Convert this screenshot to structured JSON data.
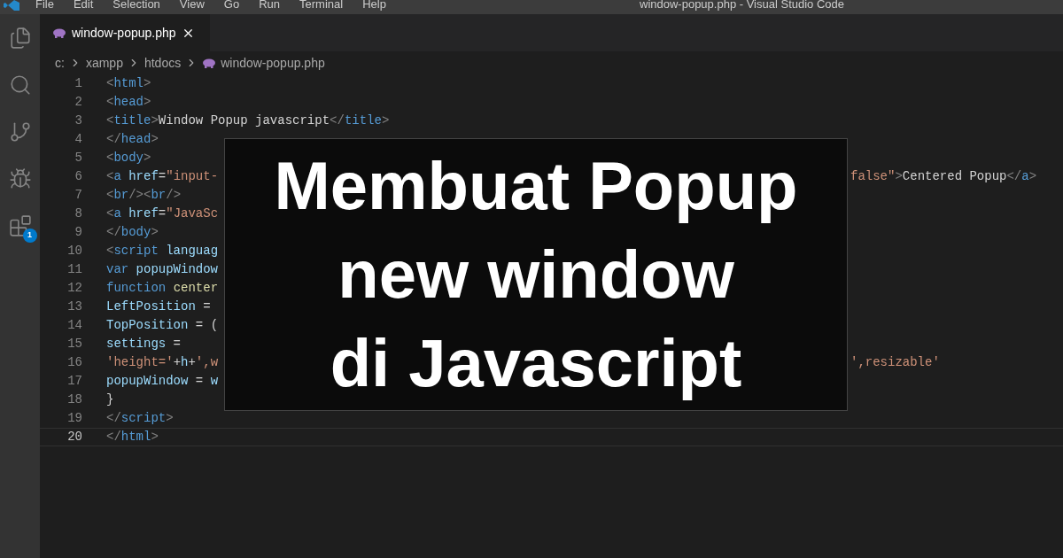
{
  "menu": [
    "File",
    "Edit",
    "Selection",
    "View",
    "Go",
    "Run",
    "Terminal",
    "Help"
  ],
  "window": {
    "title": "window-popup.php - Visual Studio Code"
  },
  "activity_bar": {
    "extensions_badge": "1"
  },
  "tabs": [
    {
      "label": "window-popup.php",
      "selected": true
    }
  ],
  "breadcrumb": [
    "c:",
    "xampp",
    "htdocs",
    "window-popup.php"
  ],
  "code_lines": [
    {
      "number": "1",
      "active": false,
      "tokens": [
        {
          "kind": "punct",
          "text": "<"
        },
        {
          "kind": "tag",
          "text": "html"
        },
        {
          "kind": "punct",
          "text": ">"
        }
      ]
    },
    {
      "number": "2",
      "active": false,
      "tokens": [
        {
          "kind": "punct",
          "text": "<"
        },
        {
          "kind": "tag",
          "text": "head"
        },
        {
          "kind": "punct",
          "text": ">"
        }
      ]
    },
    {
      "number": "3",
      "active": false,
      "tokens": [
        {
          "kind": "punct",
          "text": "<"
        },
        {
          "kind": "tag",
          "text": "title"
        },
        {
          "kind": "punct",
          "text": ">"
        },
        {
          "kind": "text",
          "text": "Window Popup javascript"
        },
        {
          "kind": "punct",
          "text": "</"
        },
        {
          "kind": "tag",
          "text": "title"
        },
        {
          "kind": "punct",
          "text": ">"
        }
      ]
    },
    {
      "number": "4",
      "active": false,
      "tokens": [
        {
          "kind": "punct",
          "text": "</"
        },
        {
          "kind": "tag",
          "text": "head"
        },
        {
          "kind": "punct",
          "text": ">"
        }
      ]
    },
    {
      "number": "5",
      "active": false,
      "tokens": [
        {
          "kind": "punct",
          "text": "<"
        },
        {
          "kind": "tag",
          "text": "body"
        },
        {
          "kind": "punct",
          "text": ">"
        }
      ]
    },
    {
      "number": "6",
      "active": false,
      "tokens": [
        {
          "kind": "punct",
          "text": "<"
        },
        {
          "kind": "tag",
          "text": "a "
        },
        {
          "kind": "attr",
          "text": "href"
        },
        {
          "kind": "text",
          "text": "="
        },
        {
          "kind": "string",
          "text": "\"input-"
        }
      ],
      "tail": [
        {
          "kind": "string",
          "text": "false\""
        },
        {
          "kind": "punct",
          "text": ">"
        },
        {
          "kind": "text",
          "text": "Centered Popup"
        },
        {
          "kind": "punct",
          "text": "</"
        },
        {
          "kind": "tag",
          "text": "a"
        },
        {
          "kind": "punct",
          "text": ">"
        }
      ]
    },
    {
      "number": "7",
      "active": false,
      "tokens": [
        {
          "kind": "punct",
          "text": "<"
        },
        {
          "kind": "tag",
          "text": "br"
        },
        {
          "kind": "punct",
          "text": "/><"
        },
        {
          "kind": "tag",
          "text": "br"
        },
        {
          "kind": "punct",
          "text": "/>"
        }
      ]
    },
    {
      "number": "8",
      "active": false,
      "tokens": [
        {
          "kind": "punct",
          "text": "<"
        },
        {
          "kind": "tag",
          "text": "a "
        },
        {
          "kind": "attr",
          "text": "href"
        },
        {
          "kind": "text",
          "text": "="
        },
        {
          "kind": "string",
          "text": "\"JavaSc"
        }
      ]
    },
    {
      "number": "9",
      "active": false,
      "tokens": [
        {
          "kind": "punct",
          "text": "</"
        },
        {
          "kind": "tag",
          "text": "body"
        },
        {
          "kind": "punct",
          "text": ">"
        }
      ]
    },
    {
      "number": "10",
      "active": false,
      "tokens": [
        {
          "kind": "punct",
          "text": "<"
        },
        {
          "kind": "tag",
          "text": "script "
        },
        {
          "kind": "attr",
          "text": "languag"
        }
      ]
    },
    {
      "number": "11",
      "active": false,
      "tokens": [
        {
          "kind": "keyword",
          "text": "var "
        },
        {
          "kind": "var",
          "text": "popupWindow"
        }
      ]
    },
    {
      "number": "12",
      "active": false,
      "tokens": [
        {
          "kind": "keyword",
          "text": "function "
        },
        {
          "kind": "func",
          "text": "center"
        }
      ]
    },
    {
      "number": "13",
      "active": false,
      "tokens": [
        {
          "kind": "var",
          "text": "LeftPosition"
        },
        {
          "kind": "text",
          "text": " ="
        }
      ]
    },
    {
      "number": "14",
      "active": false,
      "tokens": [
        {
          "kind": "var",
          "text": "TopPosition"
        },
        {
          "kind": "text",
          "text": " = ("
        }
      ]
    },
    {
      "number": "15",
      "active": false,
      "tokens": [
        {
          "kind": "var",
          "text": "settings"
        },
        {
          "kind": "text",
          "text": " ="
        }
      ]
    },
    {
      "number": "16",
      "active": false,
      "tokens": [
        {
          "kind": "string",
          "text": "'height='"
        },
        {
          "kind": "text",
          "text": "+"
        },
        {
          "kind": "var",
          "text": "h"
        },
        {
          "kind": "text",
          "text": "+"
        },
        {
          "kind": "string",
          "text": "',w"
        }
      ],
      "tail": [
        {
          "kind": "string",
          "text": "',resizable'"
        }
      ]
    },
    {
      "number": "17",
      "active": false,
      "tokens": [
        {
          "kind": "var",
          "text": "popupWindow"
        },
        {
          "kind": "text",
          "text": " = "
        },
        {
          "kind": "var",
          "text": "w"
        }
      ]
    },
    {
      "number": "18",
      "active": false,
      "tokens": [
        {
          "kind": "text",
          "text": "}"
        }
      ]
    },
    {
      "number": "19",
      "active": false,
      "tokens": [
        {
          "kind": "punct",
          "text": "</"
        },
        {
          "kind": "tag",
          "text": "script"
        },
        {
          "kind": "punct",
          "text": ">"
        }
      ]
    },
    {
      "number": "20",
      "active": true,
      "tokens": [
        {
          "kind": "punct",
          "text": "</"
        },
        {
          "kind": "tag",
          "text": "html"
        },
        {
          "kind": "punct",
          "text": ">"
        }
      ]
    }
  ],
  "overlay": {
    "lines": [
      "Membuat Popup",
      "new window",
      "di Javascript"
    ]
  }
}
